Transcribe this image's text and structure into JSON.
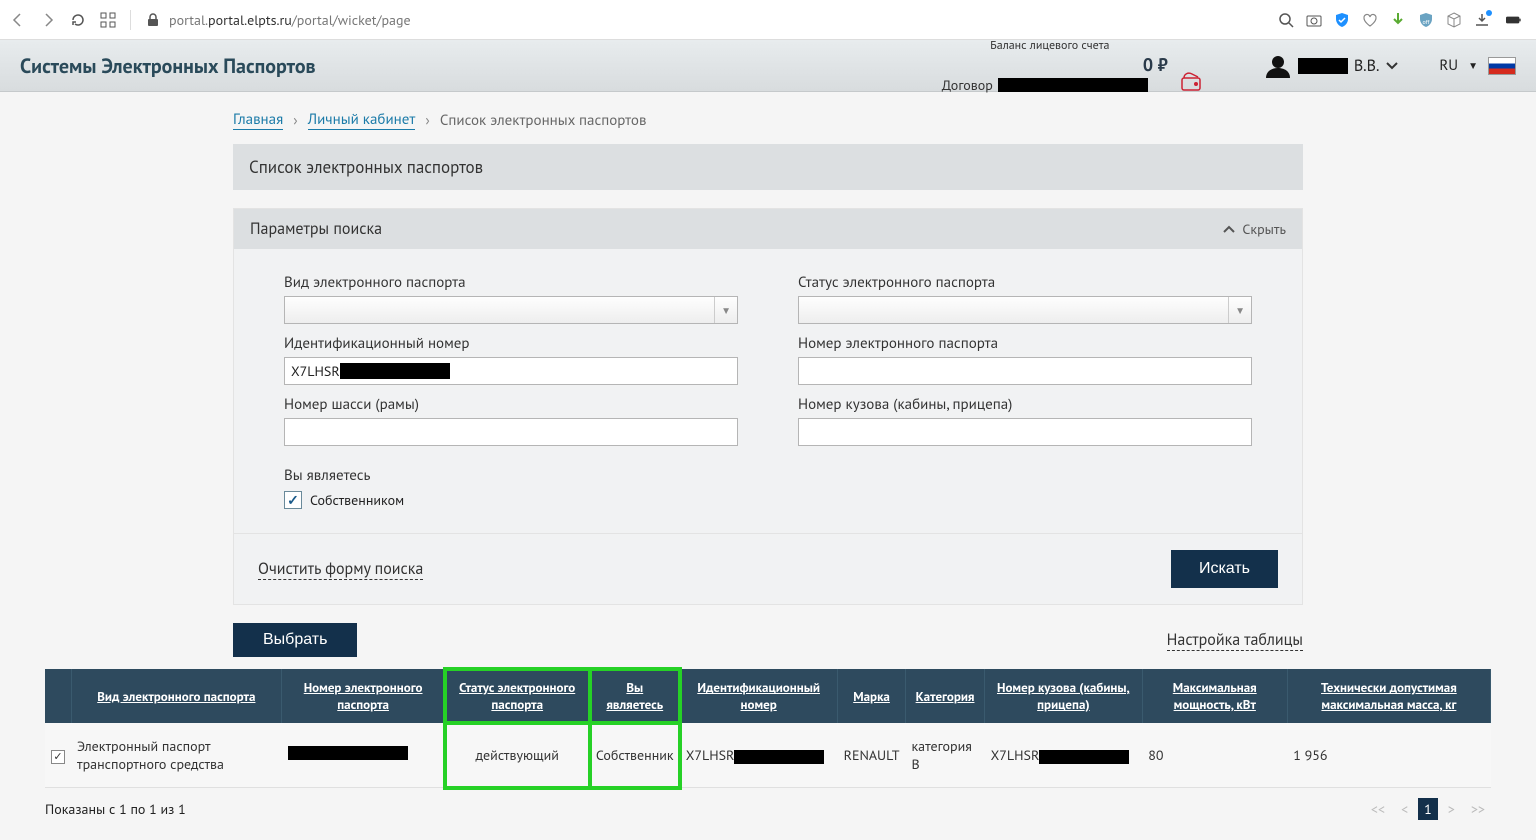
{
  "browser": {
    "url_host": "portal.elpts.ru",
    "url_path": "/portal/wicket/page"
  },
  "header": {
    "site_title": "Системы Электронных Паспортов",
    "balance_label": "Баланс лицевого счета",
    "balance_value": "0 ₽",
    "contract_label": "Договор",
    "user_initials": "В.В.",
    "lang": "RU"
  },
  "breadcrumb": {
    "home": "Главная",
    "cabinet": "Личный кабинет",
    "current": "Список электронных паспортов"
  },
  "section_title": "Список электронных паспортов",
  "search_panel": {
    "title": "Параметры поиска",
    "hide": "Скрыть",
    "fields": {
      "passport_type": "Вид электронного паспорта",
      "status": "Статус электронного паспорта",
      "ident_number": "Идентификационный номер",
      "ident_value": "X7LHSR",
      "epassport_number": "Номер электронного паспорта",
      "chassis": "Номер шасси (рамы)",
      "body": "Номер кузова (кабины, прицепа)",
      "you_are_label": "Вы являетесь",
      "owner": "Собственником"
    },
    "clear": "Очистить форму поиска",
    "search_btn": "Искать"
  },
  "table": {
    "select_btn": "Выбрать",
    "settings": "Настройка таблицы",
    "headers": {
      "type": "Вид электронного паспорта",
      "num": "Номер электронного паспорта",
      "status": "Статус электронного паспорта",
      "you_are": "Вы являетесь",
      "ident": "Идентификационный номер",
      "brand": "Марка",
      "category": "Категория",
      "body_num": "Номер кузова (кабины, прицепа)",
      "power": "Максимальная мощность, кВт",
      "mass": "Технически допустимая максимальная масса, кг"
    },
    "row": {
      "type": "Электронный паспорт транспортного средства",
      "status": "действующий",
      "you_are": "Собственник",
      "ident_prefix": "X7LHSR",
      "brand": "RENAULT",
      "category": "категория B",
      "body_prefix": "X7LHSR",
      "power": "80",
      "mass": "1 956"
    }
  },
  "pager": {
    "shown": "Показаны с 1 по 1 из 1",
    "page": "1"
  }
}
